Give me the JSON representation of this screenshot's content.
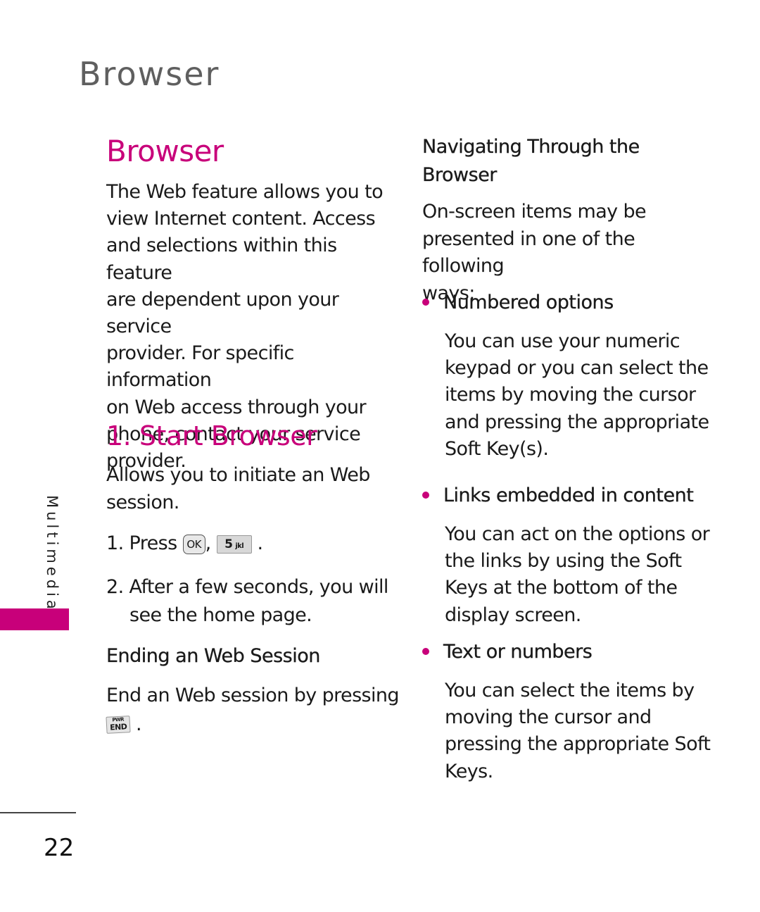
{
  "header": {
    "title": "Browser"
  },
  "side_tab": {
    "label": "Multimedia",
    "accent_color": "#c8007a"
  },
  "left_column": {
    "section_title": "Browser",
    "intro_lines": [
      "The Web feature allows you to",
      "view Internet content. Access",
      "and selections within this feature",
      "are dependent upon your service",
      "provider. For specific information",
      "on Web access through your",
      "phone, contact your service",
      "provider."
    ],
    "subsection_title": "1. Start Browser",
    "subsection_desc_lines": [
      "Allows you to initiate an Web",
      "session."
    ],
    "steps": {
      "step1_prefix": "1. Press",
      "step1_key_ok": "OK",
      "step1_sep": ",",
      "step1_key_5_main": "5",
      "step1_key_5_sub": "jkl",
      "step1_end": ".",
      "step2_line1": "2. After a few seconds, you will",
      "step2_line2": "see the home page."
    },
    "ending": {
      "heading": "Ending an Web Session",
      "text": "End an Web session by pressing",
      "key_top": "PWR",
      "key_main": "END",
      "end": "."
    }
  },
  "right_column": {
    "heading_lines": [
      "Navigating Through the",
      "Browser"
    ],
    "intro_lines": [
      "On-screen items may be",
      "presented in one of the following",
      "ways:"
    ],
    "bullets": [
      {
        "title": "Numbered options",
        "body_lines": [
          "You can use your numeric",
          "keypad or you can select the",
          "items by moving the cursor",
          "and pressing the appropriate",
          "Soft Key(s)."
        ]
      },
      {
        "title": "Links embedded in content",
        "body_lines": [
          "You can act on the options or",
          "the links by using the Soft",
          "Keys at the bottom of the",
          "display screen."
        ]
      },
      {
        "title": "Text or numbers",
        "body_lines": [
          "You can select the items by",
          "moving the cursor and",
          "pressing the appropriate Soft",
          "Keys."
        ]
      }
    ]
  },
  "footer": {
    "page_number": "22"
  }
}
